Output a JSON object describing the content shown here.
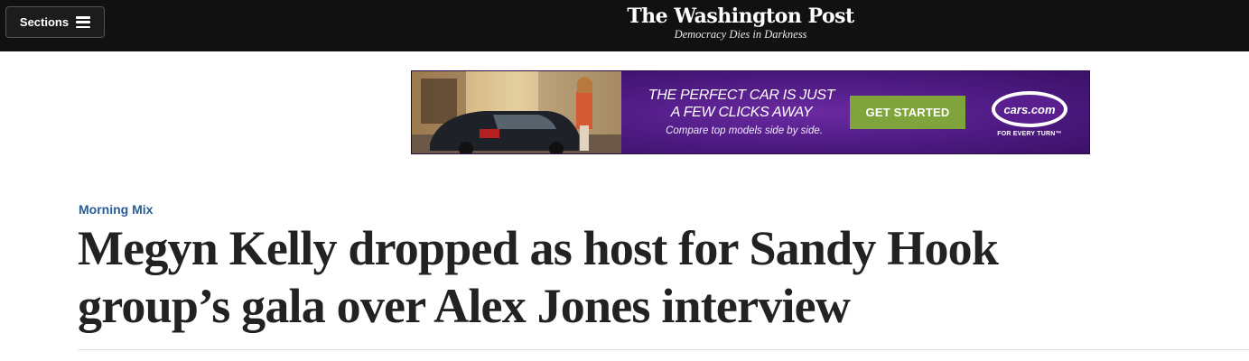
{
  "header": {
    "sections_label": "Sections",
    "logo": "The Washington Post",
    "tagline": "Democracy Dies in Darkness"
  },
  "ad": {
    "headline_line1": "THE PERFECT CAR IS JUST",
    "headline_line2": "A FEW CLICKS AWAY",
    "subtext": "Compare top models side by side.",
    "cta": "GET STARTED",
    "brand": "cars.com",
    "brand_tagline": "FOR EVERY TURN™"
  },
  "article": {
    "kicker": "Morning Mix",
    "headline_line1": "Megyn Kelly dropped as host for Sandy Hook",
    "headline_line2": "group’s gala over Alex Jones interview"
  },
  "colors": {
    "topbar": "#111111",
    "kicker": "#2a5c94",
    "ad_purple": "#4d1a82",
    "cta_green": "#7ea43b"
  }
}
